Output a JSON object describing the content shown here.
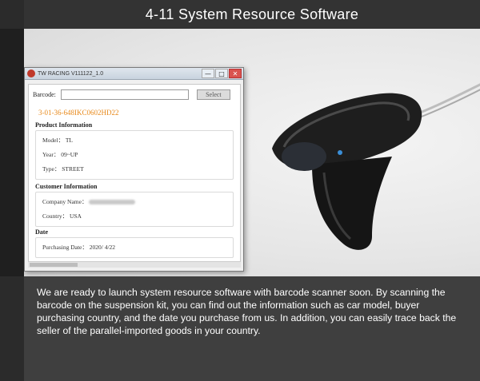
{
  "header": {
    "title": "4-11 System Resource Software"
  },
  "window": {
    "title": "TW RACING V111122_1.0",
    "controls": {
      "minimize": "—",
      "maximize": "□",
      "close": "✕"
    },
    "barcode_label": "Barcode:",
    "barcode_value": "",
    "select_label": "Select",
    "code": "3-01-36-648IKC0602HD22",
    "product": {
      "heading": "Product Information",
      "model_label": "Model：",
      "model_value": "TL",
      "year_label": "Year：",
      "year_value": "09~UP",
      "type_label": "Type：",
      "type_value": "STREET"
    },
    "customer": {
      "heading": "Customer Information",
      "company_label": "Company Name：",
      "country_label": "Country：",
      "country_value": "USA"
    },
    "date": {
      "heading": "Date",
      "purchasing_label": "Purchasing Date：",
      "purchasing_value": "2020/ 4/22"
    }
  },
  "description": "We are ready to launch system resource software with barcode scanner soon. By scanning the barcode on the suspension kit, you can find out the information such as car model, buyer purchasing country, and the date you purchase from us. In addition, you can easily trace back the seller of the parallel-imported goods in your country.",
  "colors": {
    "code_orange": "#e8891a",
    "header_bg": "#333333",
    "footer_bg": "#3f3f3f"
  }
}
